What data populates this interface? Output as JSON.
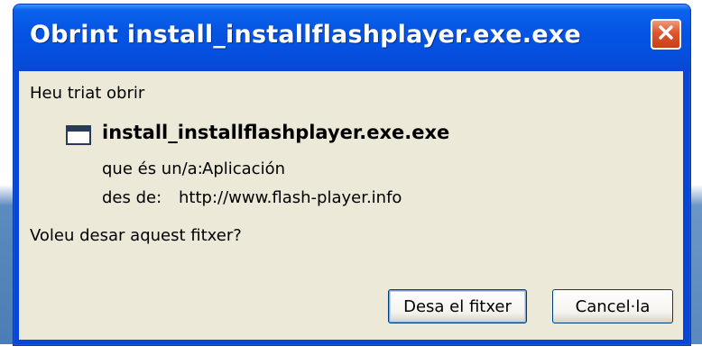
{
  "window": {
    "title": "Obrint install_installflashplayer.exe.exe",
    "close_icon": "close-icon"
  },
  "content": {
    "prompt": "Heu triat obrir",
    "file_icon": "application-window-icon",
    "file_name": "install_installflashplayer.exe.exe",
    "type_label": "que és un/a:",
    "type_value": "Aplicación",
    "from_label": "des de:",
    "from_value": "http://www.flash-player.info",
    "question": "Voleu desar aquest fitxer?"
  },
  "buttons": {
    "save_label": "Desa el fitxer",
    "cancel_label": "Cancel·la"
  },
  "colors": {
    "titlebar": "#0554e3",
    "client": "#ece9d8",
    "close_button": "#e0552a"
  }
}
